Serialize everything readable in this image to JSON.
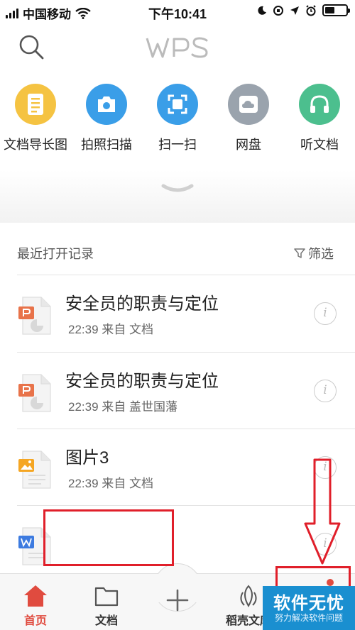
{
  "status_bar": {
    "carrier": "中国移动",
    "time": "下午10:41"
  },
  "header": {
    "logo_text": "WPS",
    "search_icon": "search-icon"
  },
  "tools": [
    {
      "label": "文档导长图",
      "icon": "long-image-icon",
      "color": "#f5c342"
    },
    {
      "label": "拍照扫描",
      "icon": "camera-icon",
      "color": "#3a9ee8"
    },
    {
      "label": "扫一扫",
      "icon": "scan-icon",
      "color": "#3a9ee8"
    },
    {
      "label": "网盘",
      "icon": "cloud-drive-icon",
      "color": "#9aa3ad"
    },
    {
      "label": "听文档",
      "icon": "headphones-icon",
      "color": "#4cbf8e"
    }
  ],
  "recent": {
    "title": "最近打开记录",
    "filter_label": "筛选",
    "items": [
      {
        "name": "安全员的职责与定位",
        "meta": "22:39  来自 文档",
        "type": "ppt"
      },
      {
        "name": "安全员的职责与定位",
        "meta": "22:39  来自 盖世国藩",
        "type": "ppt"
      },
      {
        "name": "图片3",
        "meta": "22:39  来自 文档",
        "type": "image"
      },
      {
        "name": "",
        "meta": "",
        "type": "word"
      }
    ],
    "info_glyph": "i"
  },
  "tab_bar": {
    "tabs": [
      {
        "label": "首页",
        "icon": "home-icon",
        "active": true
      },
      {
        "label": "文档",
        "icon": "folder-icon",
        "active": false
      },
      {
        "label": "稻壳文库",
        "icon": "docer-icon",
        "active": false
      }
    ],
    "fab_icon": "plus-icon"
  },
  "watermark": {
    "title": "软件无忧",
    "subtitle": "努力解决软件问题"
  },
  "colors": {
    "accent": "#e04b3f",
    "annotation": "#e01f2a",
    "watermark_bg": "#1a8fd0"
  }
}
